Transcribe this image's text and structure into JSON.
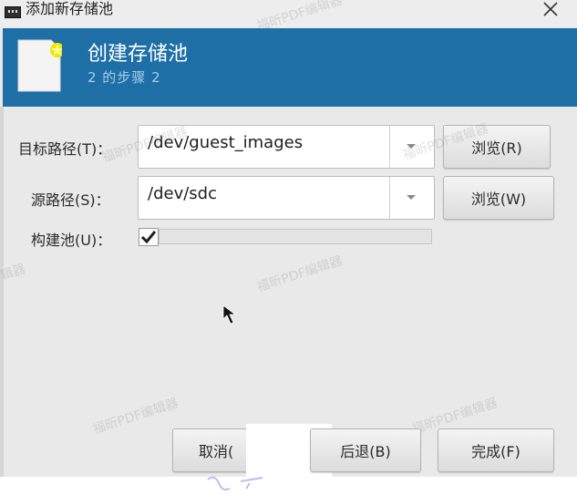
{
  "window": {
    "title": "添加新存储池",
    "close_icon": "close-icon",
    "app_icon": "storage-app-icon"
  },
  "header": {
    "title": "创建存储池",
    "step": "2 的步骤 2",
    "icon": "new-document-icon",
    "bg_color": "#1f6fa7"
  },
  "form": {
    "target_path": {
      "label": "目标路径(T)：",
      "value": "/dev/guest_images",
      "browse_label": "浏览(R)"
    },
    "source_path": {
      "label": "源路径(S)：",
      "value": "/dev/sdc",
      "browse_label": "浏览(W)"
    },
    "build_pool": {
      "label": "构建池(U)：",
      "checked": true
    }
  },
  "buttons": {
    "cancel_label": "取消(",
    "back_label": "后退(B)",
    "finish_label": "完成(F)"
  },
  "watermark": {
    "text": "福昕PDF编辑器",
    "partial": "辑器",
    "variant": "福昕PDF编辑器"
  }
}
